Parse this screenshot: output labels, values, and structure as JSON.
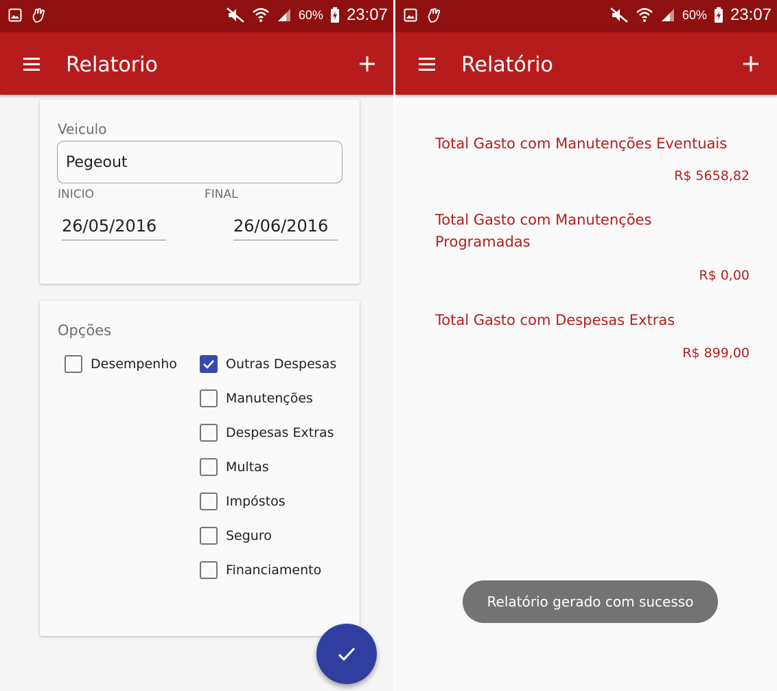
{
  "status_bar": {
    "battery_percent": "60%",
    "time": "23:07"
  },
  "left_screen": {
    "app_bar": {
      "title": "Relatorio",
      "menu_icon": "hamburger-menu-icon",
      "action_icon": "plus-icon"
    },
    "vehicle_card": {
      "vehicle_label": "Veiculo",
      "vehicle_value": "Pegeout",
      "start_label": "INICIO",
      "end_label": "FINAL",
      "start_date": "26/05/2016",
      "end_date": "26/06/2016"
    },
    "options_card": {
      "title": "Opções",
      "options": [
        {
          "label": "Desempenho",
          "checked": false
        },
        {
          "label": "Outras Despesas",
          "checked": true
        },
        {
          "label": "Manutenções",
          "checked": false
        },
        {
          "label": "Despesas Extras",
          "checked": false
        },
        {
          "label": "Multas",
          "checked": false
        },
        {
          "label": "Impóstos",
          "checked": false
        },
        {
          "label": "Seguro",
          "checked": false
        },
        {
          "label": "Financiamento",
          "checked": false
        }
      ]
    },
    "fab_icon": "checkmark-icon"
  },
  "right_screen": {
    "app_bar": {
      "title": "Relatório",
      "menu_icon": "hamburger-menu-icon",
      "action_icon": "plus-icon"
    },
    "report": [
      {
        "title": "Total Gasto com Manutenções Eventuais",
        "value": "R$ 5658,82"
      },
      {
        "title": "Total Gasto com Manutenções Programadas",
        "value": "R$ 0,00"
      },
      {
        "title": "Total Gasto com Despesas Extras",
        "value": "R$ 899,00"
      }
    ],
    "toast": "Relatório gerado com sucesso"
  },
  "colors": {
    "status_bar": "#8f1010",
    "app_bar": "#b71c1c",
    "accent": "#3949ab",
    "fab": "#303f9f",
    "report_text": "#b71c1c",
    "toast": "#737373"
  }
}
